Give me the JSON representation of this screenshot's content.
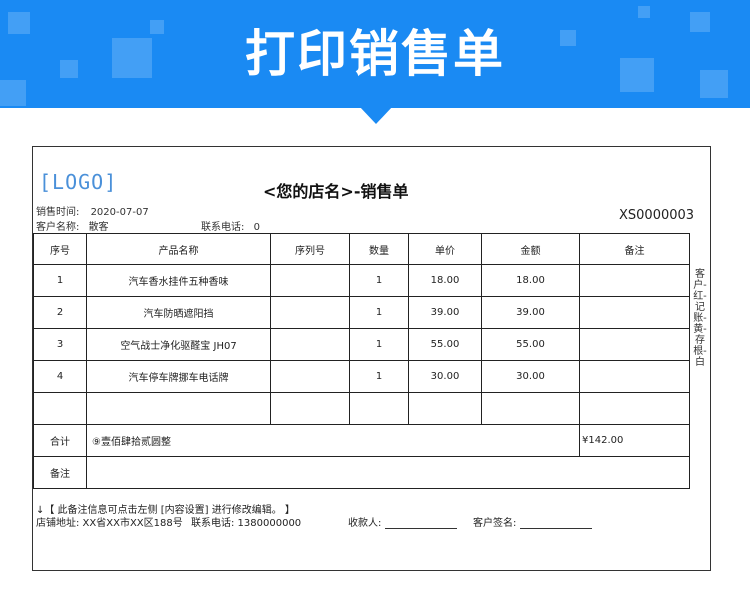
{
  "banner": {
    "title": "打印销售单",
    "color": "#1a8af3"
  },
  "header": {
    "logo": "[LOGO]",
    "title": "<您的店名>-销售单",
    "sale_time_label": "销售时间:",
    "sale_time": "2020-07-07",
    "customer_label": "客户名称:",
    "customer": "散客",
    "phone_label": "联系电话:",
    "phone": "0",
    "doc_no": "XS0000003"
  },
  "table": {
    "columns": [
      "序号",
      "产品名称",
      "序列号",
      "数量",
      "单价",
      "金额",
      "备注"
    ],
    "rows": [
      [
        "1",
        "汽车香水挂件五种香味",
        "",
        "1",
        "18.00",
        "18.00",
        ""
      ],
      [
        "2",
        "汽车防晒遮阳挡",
        "",
        "1",
        "39.00",
        "39.00",
        ""
      ],
      [
        "3",
        "空气战士净化驱醛宝 JH07",
        "",
        "1",
        "55.00",
        "55.00",
        ""
      ],
      [
        "4",
        "汽车停车牌挪车电话牌",
        "",
        "1",
        "30.00",
        "30.00",
        ""
      ],
      [
        "",
        "",
        "",
        "",
        "",
        "",
        ""
      ]
    ],
    "total_label": "合计",
    "total_words": "⑨壹佰肆拾贰圆整",
    "total_amount": "¥142.00",
    "remark_label": "备注",
    "remark": ""
  },
  "side_note": "客户-红-记账-黄-存根-白",
  "footer": {
    "note": "↓【 此备注信息可点击左侧 [内容设置] 进行修改编辑。 】",
    "address": "店铺地址: XX省XX市XX区188号",
    "contact": "联系电话: 1380000000",
    "payee_label": "收款人:",
    "sign_label": "客户签名:"
  }
}
